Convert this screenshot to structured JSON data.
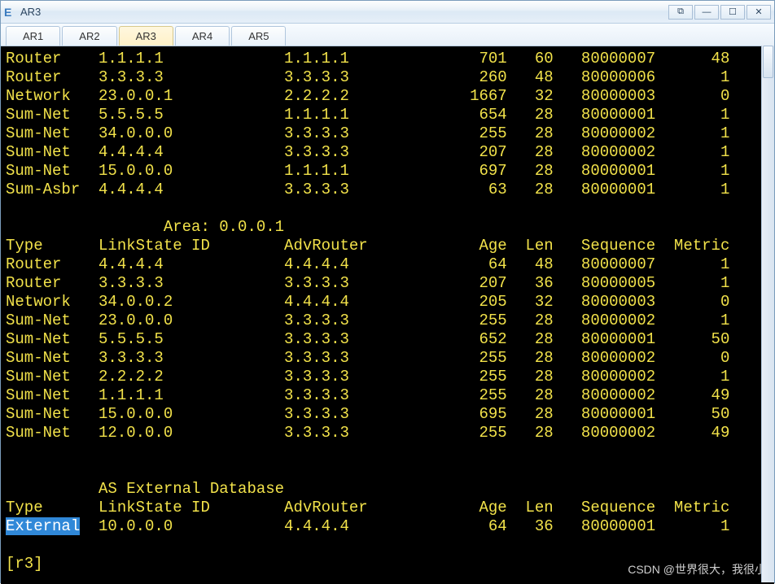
{
  "window": {
    "title": "AR3",
    "app_icon_text": "E"
  },
  "tabs": [
    {
      "label": "AR1",
      "active": false
    },
    {
      "label": "AR2",
      "active": false
    },
    {
      "label": "AR3",
      "active": true
    },
    {
      "label": "AR4",
      "active": false
    },
    {
      "label": "AR5",
      "active": false
    }
  ],
  "winbtns": {
    "popout": "⧉",
    "min": "—",
    "max": "☐",
    "close": "✕"
  },
  "section0_rows": [
    {
      "type": "Router",
      "lsid": "1.1.1.1",
      "adv": "1.1.1.1",
      "age": "701",
      "len": "60",
      "seq": "80000007",
      "metric": "48"
    },
    {
      "type": "Router",
      "lsid": "3.3.3.3",
      "adv": "3.3.3.3",
      "age": "260",
      "len": "48",
      "seq": "80000006",
      "metric": "1"
    },
    {
      "type": "Network",
      "lsid": "23.0.0.1",
      "adv": "2.2.2.2",
      "age": "1667",
      "len": "32",
      "seq": "80000003",
      "metric": "0"
    },
    {
      "type": "Sum-Net",
      "lsid": "5.5.5.5",
      "adv": "1.1.1.1",
      "age": "654",
      "len": "28",
      "seq": "80000001",
      "metric": "1"
    },
    {
      "type": "Sum-Net",
      "lsid": "34.0.0.0",
      "adv": "3.3.3.3",
      "age": "255",
      "len": "28",
      "seq": "80000002",
      "metric": "1"
    },
    {
      "type": "Sum-Net",
      "lsid": "4.4.4.4",
      "adv": "3.3.3.3",
      "age": "207",
      "len": "28",
      "seq": "80000002",
      "metric": "1"
    },
    {
      "type": "Sum-Net",
      "lsid": "15.0.0.0",
      "adv": "1.1.1.1",
      "age": "697",
      "len": "28",
      "seq": "80000001",
      "metric": "1"
    },
    {
      "type": "Sum-Asbr",
      "lsid": "4.4.4.4",
      "adv": "3.3.3.3",
      "age": "63",
      "len": "28",
      "seq": "80000001",
      "metric": "1"
    }
  ],
  "area_header": "Area: 0.0.0.1",
  "columns": {
    "type": "Type",
    "lsid": "LinkState ID",
    "adv": "AdvRouter",
    "age": "Age",
    "len": "Len",
    "seq": "Sequence",
    "metric": "Metric"
  },
  "section1_rows": [
    {
      "type": "Router",
      "lsid": "4.4.4.4",
      "adv": "4.4.4.4",
      "age": "64",
      "len": "48",
      "seq": "80000007",
      "metric": "1"
    },
    {
      "type": "Router",
      "lsid": "3.3.3.3",
      "adv": "3.3.3.3",
      "age": "207",
      "len": "36",
      "seq": "80000005",
      "metric": "1"
    },
    {
      "type": "Network",
      "lsid": "34.0.0.2",
      "adv": "4.4.4.4",
      "age": "205",
      "len": "32",
      "seq": "80000003",
      "metric": "0"
    },
    {
      "type": "Sum-Net",
      "lsid": "23.0.0.0",
      "adv": "3.3.3.3",
      "age": "255",
      "len": "28",
      "seq": "80000002",
      "metric": "1"
    },
    {
      "type": "Sum-Net",
      "lsid": "5.5.5.5",
      "adv": "3.3.3.3",
      "age": "652",
      "len": "28",
      "seq": "80000001",
      "metric": "50"
    },
    {
      "type": "Sum-Net",
      "lsid": "3.3.3.3",
      "adv": "3.3.3.3",
      "age": "255",
      "len": "28",
      "seq": "80000002",
      "metric": "0"
    },
    {
      "type": "Sum-Net",
      "lsid": "2.2.2.2",
      "adv": "3.3.3.3",
      "age": "255",
      "len": "28",
      "seq": "80000002",
      "metric": "1"
    },
    {
      "type": "Sum-Net",
      "lsid": "1.1.1.1",
      "adv": "3.3.3.3",
      "age": "255",
      "len": "28",
      "seq": "80000002",
      "metric": "49"
    },
    {
      "type": "Sum-Net",
      "lsid": "15.0.0.0",
      "adv": "3.3.3.3",
      "age": "695",
      "len": "28",
      "seq": "80000001",
      "metric": "50"
    },
    {
      "type": "Sum-Net",
      "lsid": "12.0.0.0",
      "adv": "3.3.3.3",
      "age": "255",
      "len": "28",
      "seq": "80000002",
      "metric": "49"
    }
  ],
  "ext_header": "AS External Database",
  "ext_rows": [
    {
      "type": "External",
      "lsid": "10.0.0.0",
      "adv": "4.4.4.4",
      "age": "64",
      "len": "36",
      "seq": "80000001",
      "metric": "1"
    }
  ],
  "ext_highlight_type": true,
  "ext_lsid_display": "10.0.0.0",
  "prompt": "[r3]",
  "watermark": "CSDN @世界很大，我很小"
}
